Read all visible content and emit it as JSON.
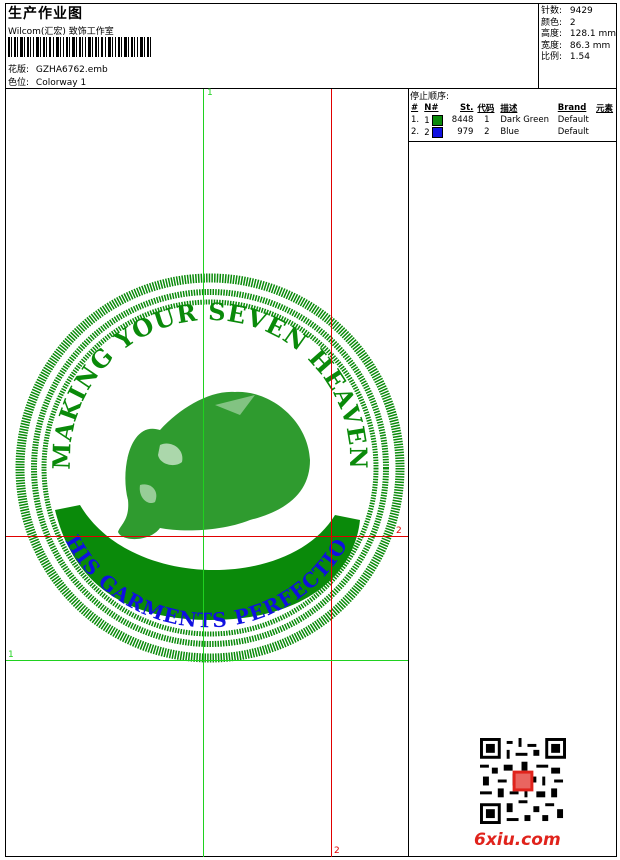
{
  "header": {
    "title": "生产作业图",
    "subtitle": "Wilcom(汇宏) 致饰工作室",
    "design_label": "花版:",
    "design_value": "GZHA6762.emb",
    "colorway_label": "色位:",
    "colorway_value": "Colorway 1"
  },
  "stats": {
    "stitches_label": "针数:",
    "stitches_value": "9429",
    "colors_label": "颜色:",
    "colors_value": "2",
    "height_label": "高度:",
    "height_value": "128.1 mm",
    "width_label": "宽度:",
    "width_value": "86.3 mm",
    "ratio_label": "比例:",
    "ratio_value": "1.54"
  },
  "sequence": {
    "title": "停止顺序:",
    "headers": [
      "#",
      "N#",
      "St.",
      "代码",
      "描述",
      "Brand",
      "元素"
    ],
    "rows": [
      {
        "idx": "1.",
        "n": "1",
        "color": "#0a8a0a",
        "st": "8448",
        "code": "1",
        "desc": "Dark Green",
        "brand": "Default"
      },
      {
        "idx": "2.",
        "n": "2",
        "color": "#1010e0",
        "st": "979",
        "code": "2",
        "desc": "Blue",
        "brand": "Default"
      }
    ]
  },
  "guides": {
    "v1": "1",
    "v2": "2",
    "h1": "1",
    "h2": "2"
  },
  "embroidery": {
    "top_text": "MAKING YOUR SEVEN HEAVEN",
    "bottom_text": "THIS GARMENTS PERFECTION",
    "green": "#0a8a0a",
    "blue": "#1010e0"
  },
  "watermark": {
    "logo_text": "6xiu.com"
  }
}
